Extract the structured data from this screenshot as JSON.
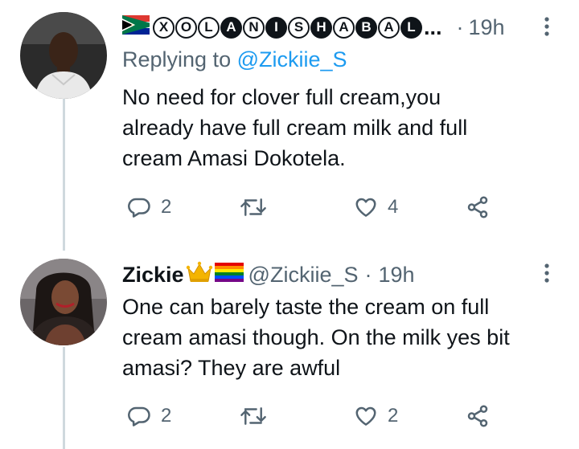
{
  "tweets": [
    {
      "name_letters": [
        "X",
        "O",
        "L",
        "A",
        "N",
        "I",
        "S",
        "H",
        "A",
        "B",
        "A",
        "L"
      ],
      "name_ellipsis": "...",
      "separator": "·",
      "time": "19h",
      "replying_prefix": "Replying to ",
      "replying_handle": "@Zickiie_S",
      "body_lines": [
        "No need for clover full cream,you",
        "already have full cream milk and full",
        "cream Amasi Dokotela."
      ],
      "reply_count": "2",
      "retweet_count": "",
      "like_count": "4"
    },
    {
      "name": "Zickie",
      "handle": "@Zickiie_S",
      "separator": "·",
      "time": "19h",
      "body_lines": [
        "One can barely taste the cream on full",
        "cream amasi though. On the milk yes bit",
        "amasi? They are awful"
      ],
      "reply_count": "2",
      "retweet_count": "",
      "like_count": "2"
    }
  ],
  "colors": {
    "link": "#1d9bf0",
    "muted": "#536471",
    "text": "#0f1419",
    "thread_line": "#cfd9de"
  },
  "icons": [
    "reply-icon",
    "retweet-icon",
    "like-icon",
    "share-icon",
    "more-options-icon",
    "south-africa-flag-icon",
    "crown-icon",
    "rainbow-flag-icon"
  ]
}
